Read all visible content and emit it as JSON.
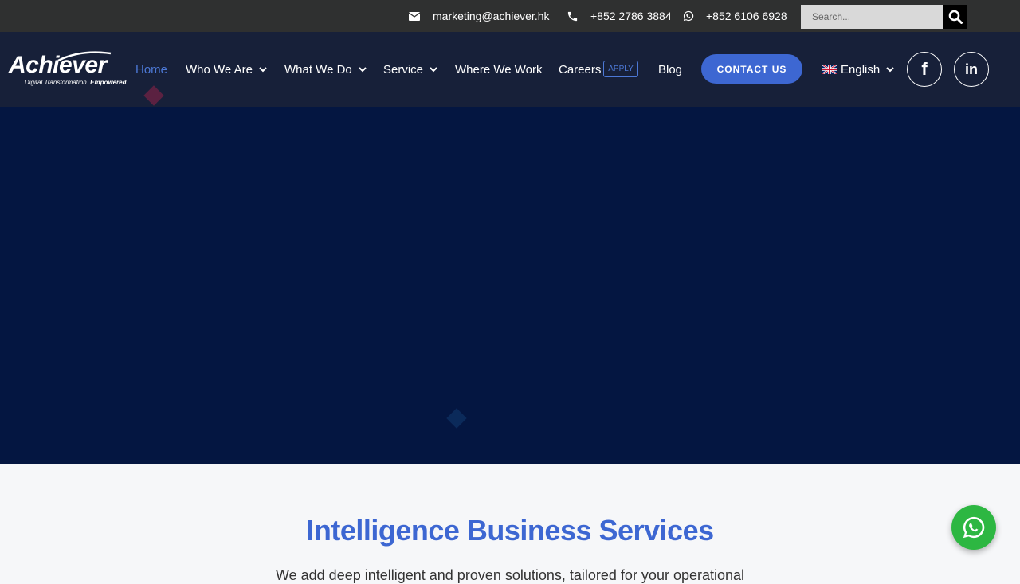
{
  "topbar": {
    "email": "marketing@achiever.hk",
    "phone": "+852 2786 3884",
    "whatsapp": "+852 6106 6928",
    "search_placeholder": "Search..."
  },
  "logo": {
    "wordmark": "Achiever",
    "tagline_italic": "Digital Transformation.",
    "tagline_bold": "Empowered."
  },
  "nav": {
    "home": "Home",
    "who_we_are": "Who We Are",
    "what_we_do": "What We Do",
    "service": "Service",
    "where_we_work": "Where We Work",
    "careers": "Careers",
    "apply_badge": "APPLY",
    "blog": "Blog",
    "contact_button": "CONTACT US",
    "language": "English"
  },
  "social": {
    "facebook": "f",
    "linkedin": "in"
  },
  "section": {
    "title": "Intelligence Business Services",
    "subtitle": "We add deep intelligent and proven solutions, tailored for your operational"
  },
  "colors": {
    "accent": "#3d67d2",
    "hero_bg": "#041641",
    "header_bg": "#172039",
    "topbar_bg": "#2f3030",
    "whatsapp": "#2db742"
  }
}
